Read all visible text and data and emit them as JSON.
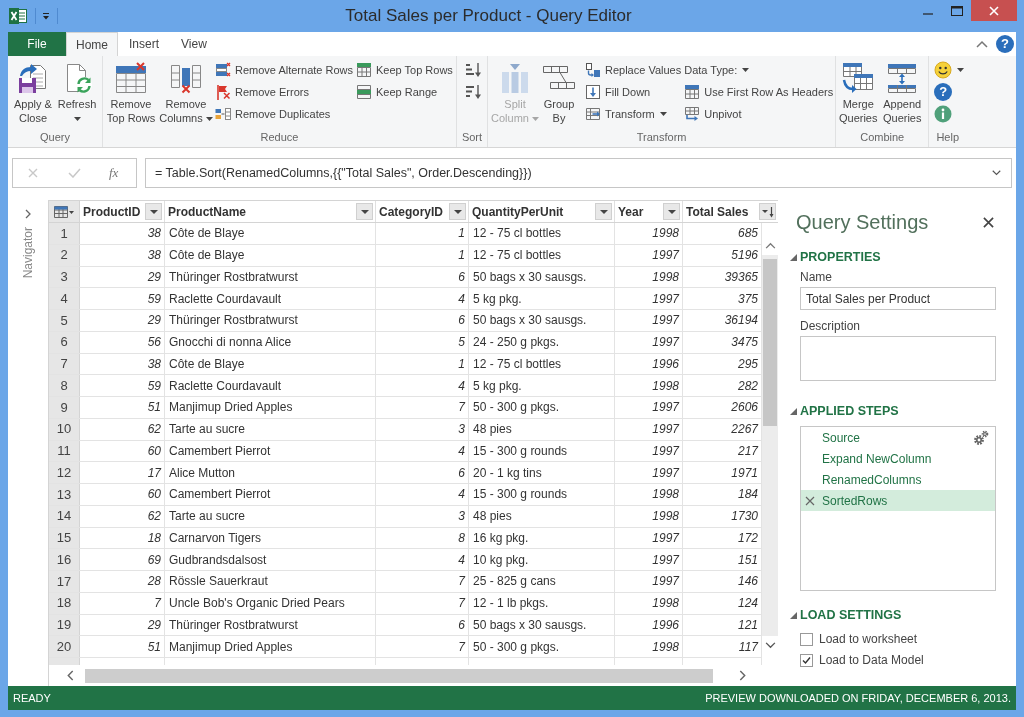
{
  "window": {
    "title": "Total Sales per Product - Query Editor"
  },
  "ribbon": {
    "tabs": [
      {
        "label": "File",
        "kind": "file",
        "selected": false
      },
      {
        "label": "Home",
        "kind": "tab",
        "selected": true
      },
      {
        "label": "Insert",
        "kind": "tab",
        "selected": false
      },
      {
        "label": "View",
        "kind": "tab",
        "selected": false
      }
    ],
    "help_glyph": "?",
    "groups": [
      {
        "label": "Query",
        "items": [
          {
            "kind": "large",
            "label": "Apply & Close",
            "dropdown": false,
            "disabled": false
          },
          {
            "kind": "large",
            "label": "Refresh",
            "dropdown": true,
            "disabled": false
          }
        ]
      },
      {
        "label": "Reduce",
        "items": [
          {
            "kind": "large",
            "label": "Remove Top Rows",
            "dropdown": false,
            "disabled": false
          },
          {
            "kind": "large",
            "label": "Remove Columns",
            "dropdown": true,
            "disabled": false
          },
          {
            "kind": "stack",
            "buttons": [
              {
                "label": "Remove Alternate Rows",
                "dropdown": false,
                "disabled": false
              },
              {
                "label": "Remove Errors",
                "dropdown": false,
                "disabled": false
              },
              {
                "label": "Remove Duplicates",
                "dropdown": false,
                "disabled": false
              }
            ]
          },
          {
            "kind": "stack",
            "buttons": [
              {
                "label": "Keep Top Rows",
                "dropdown": false,
                "disabled": false
              },
              {
                "label": "Keep Range",
                "dropdown": false,
                "disabled": false
              }
            ]
          }
        ]
      },
      {
        "label": "Sort",
        "items": [
          {
            "kind": "stack",
            "buttons": [
              {
                "dropdown": false,
                "disabled": false
              },
              {
                "dropdown": false,
                "disabled": false
              }
            ]
          }
        ]
      },
      {
        "label": "Transform",
        "items": [
          {
            "kind": "large",
            "label": "Split Column",
            "dropdown": true,
            "disabled": true
          },
          {
            "kind": "large",
            "label": "Group By",
            "dropdown": false,
            "disabled": false
          },
          {
            "kind": "stack",
            "buttons": [
              {
                "label": "Replace Values",
                "dropdown": false,
                "disabled": false
              },
              {
                "label": "Fill Down",
                "dropdown": false,
                "disabled": false
              },
              {
                "label": "Transform",
                "dropdown": true,
                "disabled": false
              }
            ]
          },
          {
            "kind": "stack",
            "buttons": [
              {
                "label": "Data Type:",
                "dropdown": true,
                "disabled": false
              },
              {
                "label": "Use First Row As Headers",
                "dropdown": false,
                "disabled": false
              },
              {
                "label": "Unpivot",
                "dropdown": false,
                "disabled": false
              }
            ]
          }
        ]
      },
      {
        "label": "Combine",
        "items": [
          {
            "kind": "large",
            "label": "Merge Queries",
            "dropdown": false,
            "disabled": false
          },
          {
            "kind": "large",
            "label": "Append Queries",
            "dropdown": false,
            "disabled": false
          }
        ]
      },
      {
        "label": "Help",
        "items": [
          {
            "kind": "stack",
            "buttons": [
              {
                "dropdown": true,
                "disabled": false
              },
              {
                "glyph": "?",
                "dropdown": false,
                "disabled": false
              },
              {
                "dropdown": false,
                "disabled": false
              }
            ]
          }
        ]
      }
    ]
  },
  "formula_bar": {
    "function_label": "fx",
    "formula": "= Table.Sort(RenamedColumns,{{\"Total Sales\", Order.Descending}})"
  },
  "navigator": {
    "label": "Navigator",
    "expanded": false
  },
  "table": {
    "columns": [
      {
        "label": "ProductID",
        "kind": "number",
        "sorted": false
      },
      {
        "label": "ProductName",
        "kind": "text",
        "sorted": false
      },
      {
        "label": "CategoryID",
        "kind": "number",
        "sorted": false
      },
      {
        "label": "QuantityPerUnit",
        "kind": "text",
        "sorted": false
      },
      {
        "label": "Year",
        "kind": "number",
        "sorted": false
      },
      {
        "label": "Total Sales",
        "kind": "number",
        "sorted": true
      }
    ],
    "rows": [
      {
        "number": "1",
        "cells": [
          "38",
          "Côte de Blaye",
          "1",
          "12 - 75 cl bottles",
          "1998",
          "685"
        ]
      },
      {
        "number": "2",
        "cells": [
          "38",
          "Côte de Blaye",
          "1",
          "12 - 75 cl bottles",
          "1997",
          "5196"
        ]
      },
      {
        "number": "3",
        "cells": [
          "29",
          "Thüringer Rostbratwurst",
          "6",
          "50 bags x 30 sausgs.",
          "1998",
          "39365"
        ]
      },
      {
        "number": "4",
        "cells": [
          "59",
          "Raclette Courdavault",
          "4",
          "5 kg pkg.",
          "1997",
          "375"
        ]
      },
      {
        "number": "5",
        "cells": [
          "29",
          "Thüringer Rostbratwurst",
          "6",
          "50 bags x 30 sausgs.",
          "1997",
          "36194"
        ]
      },
      {
        "number": "6",
        "cells": [
          "56",
          "Gnocchi di nonna Alice",
          "5",
          "24 - 250 g pkgs.",
          "1997",
          "3475"
        ]
      },
      {
        "number": "7",
        "cells": [
          "38",
          "Côte de Blaye",
          "1",
          "12 - 75 cl bottles",
          "1996",
          "295"
        ]
      },
      {
        "number": "8",
        "cells": [
          "59",
          "Raclette Courdavault",
          "4",
          "5 kg pkg.",
          "1998",
          "282"
        ]
      },
      {
        "number": "9",
        "cells": [
          "51",
          "Manjimup Dried Apples",
          "7",
          "50 - 300 g pkgs.",
          "1997",
          "2606"
        ]
      },
      {
        "number": "10",
        "cells": [
          "62",
          "Tarte au sucre",
          "3",
          "48 pies",
          "1997",
          "2267"
        ]
      },
      {
        "number": "11",
        "cells": [
          "60",
          "Camembert Pierrot",
          "4",
          "15 - 300 g rounds",
          "1997",
          "217"
        ]
      },
      {
        "number": "12",
        "cells": [
          "17",
          "Alice Mutton",
          "6",
          "20 - 1 kg tins",
          "1997",
          "1971"
        ]
      },
      {
        "number": "13",
        "cells": [
          "60",
          "Camembert Pierrot",
          "4",
          "15 - 300 g rounds",
          "1998",
          "184"
        ]
      },
      {
        "number": "14",
        "cells": [
          "62",
          "Tarte au sucre",
          "3",
          "48 pies",
          "1998",
          "1730"
        ]
      },
      {
        "number": "15",
        "cells": [
          "18",
          "Carnarvon Tigers",
          "8",
          "16 kg pkg.",
          "1997",
          "172"
        ]
      },
      {
        "number": "16",
        "cells": [
          "69",
          "Gudbrandsdalsost",
          "4",
          "10 kg pkg.",
          "1997",
          "151"
        ]
      },
      {
        "number": "17",
        "cells": [
          "28",
          "Rössle Sauerkraut",
          "7",
          "25 - 825 g cans",
          "1997",
          "146"
        ]
      },
      {
        "number": "18",
        "cells": [
          "7",
          "Uncle Bob's Organic Dried Pears",
          "7",
          "12 - 1 lb pkgs.",
          "1998",
          "124"
        ]
      },
      {
        "number": "19",
        "cells": [
          "29",
          "Thüringer Rostbratwurst",
          "6",
          "50 bags x 30 sausgs.",
          "1996",
          "121"
        ]
      },
      {
        "number": "20",
        "cells": [
          "51",
          "Manjimup Dried Apples",
          "7",
          "50 - 300 g pkgs.",
          "1998",
          "117"
        ]
      }
    ]
  },
  "query_settings": {
    "title": "Query Settings",
    "properties": {
      "heading": "PROPERTIES",
      "expanded": true,
      "name_label": "Name",
      "name_value": "Total Sales per Product",
      "description_label": "Description"
    },
    "applied_steps": {
      "heading": "APPLIED STEPS",
      "expanded": true,
      "steps": [
        {
          "label": "Source",
          "selected": false,
          "has_settings": true
        },
        {
          "label": "Expand NewColumn",
          "selected": false,
          "has_settings": false
        },
        {
          "label": "RenamedColumns",
          "selected": false,
          "has_settings": false
        },
        {
          "label": "SortedRows",
          "selected": true,
          "has_settings": false
        }
      ]
    },
    "load_settings": {
      "heading": "LOAD SETTINGS",
      "expanded": true,
      "options": [
        {
          "label": "Load to worksheet",
          "checked": false
        },
        {
          "label": "Load to Data Model",
          "checked": true
        }
      ]
    }
  },
  "status_bar": {
    "left": "READY",
    "right": "PREVIEW DOWNLOADED ON FRIDAY, DECEMBER 6, 2013."
  }
}
